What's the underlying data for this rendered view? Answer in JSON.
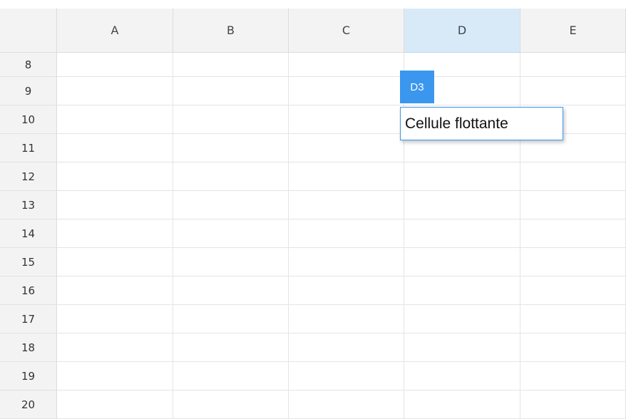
{
  "spreadsheet": {
    "columns": [
      "A",
      "B",
      "C",
      "D",
      "E"
    ],
    "active_column": "D",
    "rows": [
      "8",
      "9",
      "10",
      "11",
      "12",
      "13",
      "14",
      "15",
      "16",
      "17",
      "18",
      "19",
      "20"
    ]
  },
  "floating_cell": {
    "reference": "D3",
    "value": "Cellule flottante"
  },
  "colors": {
    "accent": "#3b97ee",
    "header_bg": "#f3f3f3",
    "active_header_bg": "#d8eaf8",
    "gridline": "#e4e4e4"
  }
}
